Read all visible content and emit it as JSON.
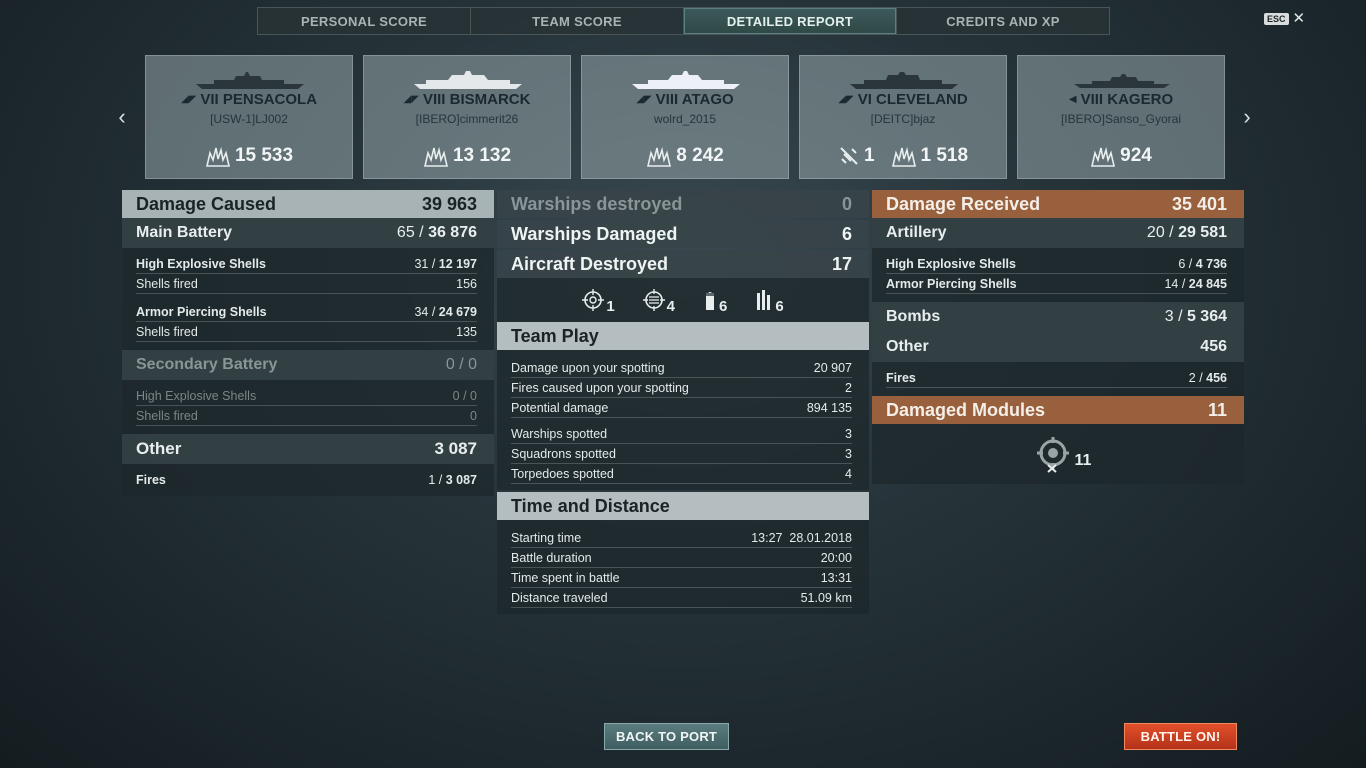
{
  "tabs": [
    {
      "label": "PERSONAL SCORE",
      "active": false
    },
    {
      "label": "TEAM SCORE",
      "active": false
    },
    {
      "label": "DETAILED REPORT",
      "active": true
    },
    {
      "label": "CREDITS AND XP",
      "active": false
    }
  ],
  "esc_label": "ESC",
  "close_glyph": "✕",
  "nav": {
    "prev_glyph": "‹",
    "next_glyph": "›"
  },
  "ships": [
    {
      "name": "VII PENSACOLA",
      "player": "[USW-1]LJ002",
      "damage": "15 533"
    },
    {
      "name": "VIII BISMARCK",
      "player": "[IBERO]cimmerit26",
      "damage": "13 132"
    },
    {
      "name": "VIII ATAGO",
      "player": "wolrd_2015",
      "damage": "8 242"
    },
    {
      "name": "VI CLEVELAND",
      "player": "[DEITC]bjaz",
      "planes": "1",
      "damage": "1 518"
    },
    {
      "name": "VIII KAGERO",
      "player": "[IBERO]Sanso_Gyorai",
      "damage": "924"
    }
  ],
  "left": {
    "damage_caused": {
      "label": "Damage Caused",
      "value": "39 963"
    },
    "main_battery": {
      "label": "Main Battery",
      "hits": "65 / ",
      "dmg": "36 876"
    },
    "he": {
      "label": "High Explosive Shells",
      "hits": "31 / ",
      "dmg": "12 197"
    },
    "he_fired": {
      "label": "Shells fired",
      "value": "156"
    },
    "ap": {
      "label": "Armor Piercing Shells",
      "hits": "34 / ",
      "dmg": "24 679"
    },
    "ap_fired": {
      "label": "Shells fired",
      "value": "135"
    },
    "secondary": {
      "label": "Secondary Battery",
      "value": "0 / 0"
    },
    "sec_he": {
      "label": "High Explosive Shells",
      "value": "0 / 0"
    },
    "sec_fired": {
      "label": "Shells fired",
      "value": "0"
    },
    "other": {
      "label": "Other",
      "value": "3 087"
    },
    "fires": {
      "label": "Fires",
      "hits": "1 / ",
      "dmg": "3 087"
    }
  },
  "mid": {
    "destroyed": {
      "label": "Warships destroyed",
      "value": "0"
    },
    "damaged": {
      "label": "Warships Damaged",
      "value": "6"
    },
    "aircraft": {
      "label": "Aircraft Destroyed",
      "value": "17"
    },
    "ribbons": [
      {
        "icon": "crosshair-icon",
        "count": "1"
      },
      {
        "icon": "crosshair-hit-icon",
        "count": "4"
      },
      {
        "icon": "shell-icon",
        "count": "6"
      },
      {
        "icon": "shells-icon",
        "count": "6"
      }
    ],
    "team_play": {
      "title": "Team Play",
      "rows": [
        {
          "label": "Damage upon your spotting",
          "value": "20 907"
        },
        {
          "label": "Fires caused upon your spotting",
          "value": "2"
        },
        {
          "label": "Potential damage",
          "value": "894 135"
        },
        {
          "label": "Warships spotted",
          "value": "3"
        },
        {
          "label": "Squadrons spotted",
          "value": "3"
        },
        {
          "label": "Torpedoes spotted",
          "value": "4"
        }
      ]
    },
    "time_distance": {
      "title": "Time and Distance",
      "rows": [
        {
          "label": "Starting time",
          "value": "13:27  28.01.2018"
        },
        {
          "label": "Battle duration",
          "value": "20:00"
        },
        {
          "label": "Time spent in battle",
          "value": "13:31"
        },
        {
          "label": "Distance traveled",
          "value": "51.09 km"
        }
      ]
    }
  },
  "right": {
    "received": {
      "label": "Damage Received",
      "value": "35 401"
    },
    "artillery": {
      "label": "Artillery",
      "hits": "20 / ",
      "dmg": "29 581"
    },
    "he": {
      "label": "High Explosive Shells",
      "hits": "6 / ",
      "dmg": "4 736"
    },
    "ap": {
      "label": "Armor Piercing Shells",
      "hits": "14 / ",
      "dmg": "24 845"
    },
    "bombs": {
      "label": "Bombs",
      "hits": "3 / ",
      "dmg": "5 364"
    },
    "other": {
      "label": "Other",
      "value": "456"
    },
    "fires": {
      "label": "Fires",
      "hits": "2 / ",
      "dmg": "456"
    },
    "modules": {
      "label": "Damaged Modules",
      "value": "11"
    },
    "module_icon_count": "11"
  },
  "buttons": {
    "back": "BACK TO PORT",
    "battle": "BATTLE ON!"
  },
  "colors": {
    "accent_orange": "#98603c",
    "battle_red": "#d8442a",
    "tab_active": "#3d5a5a"
  }
}
